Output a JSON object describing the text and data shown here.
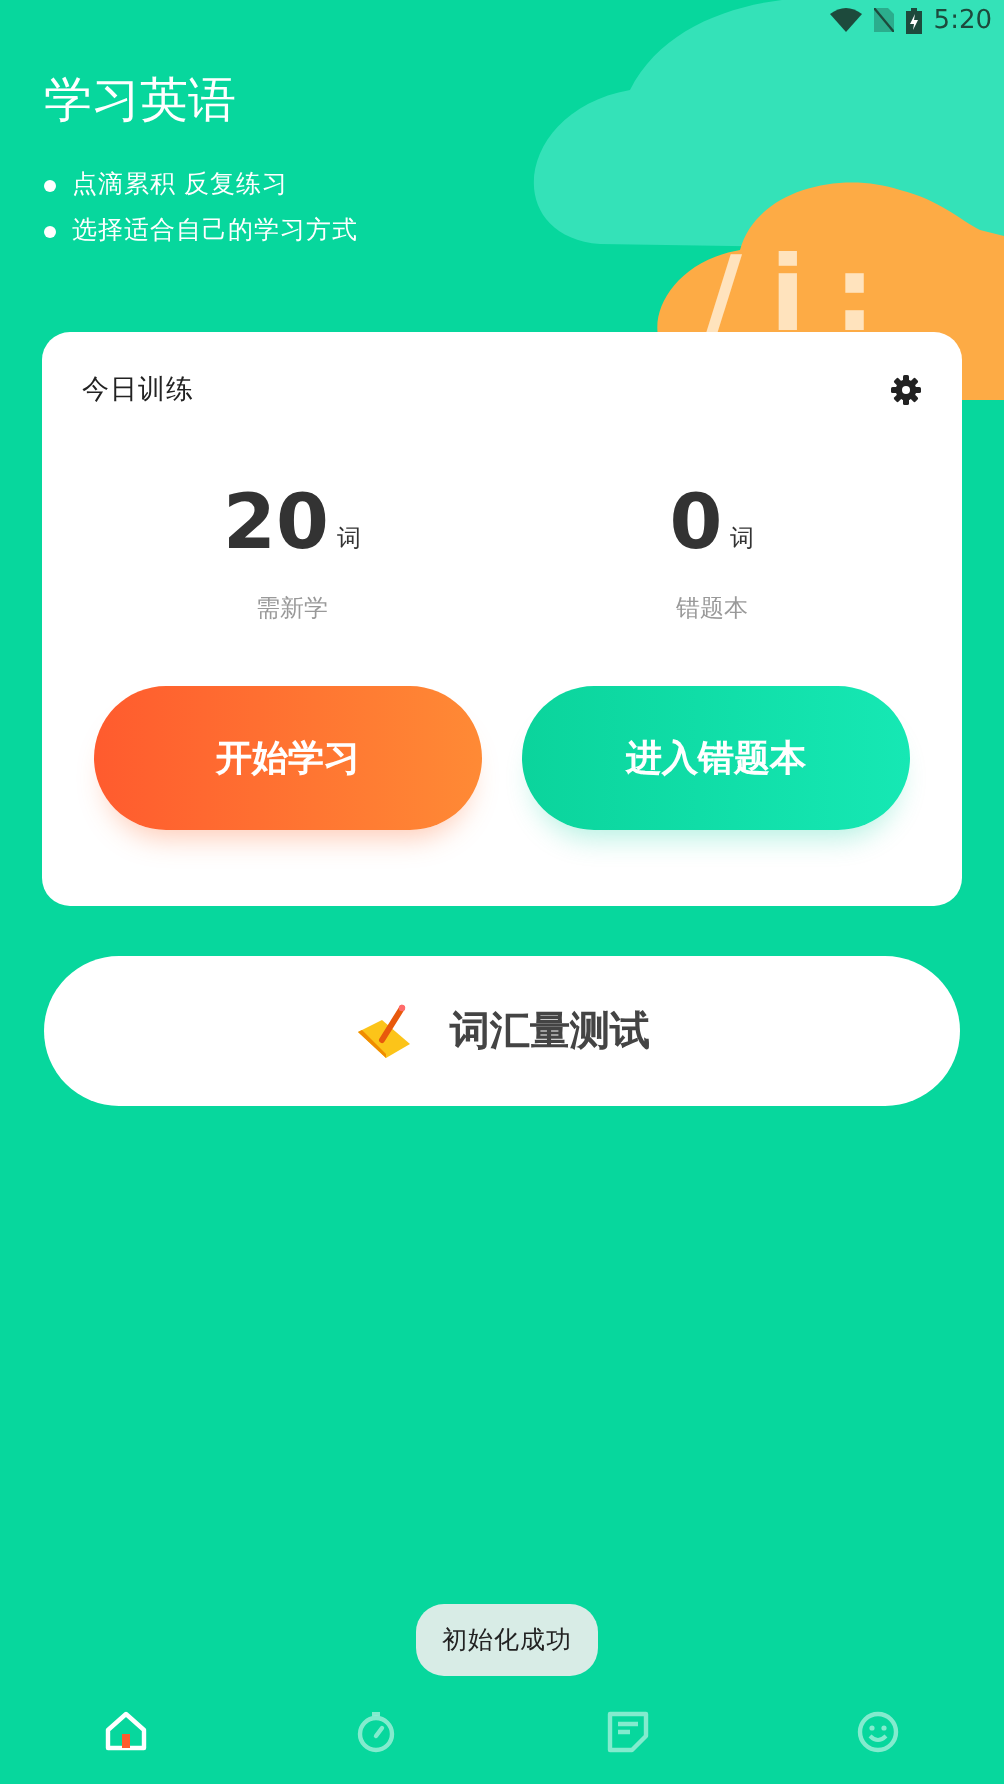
{
  "status_bar": {
    "time": "5:20"
  },
  "header": {
    "title": "学习英语",
    "bullets": [
      "点滴累积 反复练习",
      "选择适合自己的学习方式"
    ],
    "decor_text": "/i:"
  },
  "card": {
    "title": "今日训练",
    "stats": [
      {
        "value": "20",
        "unit": "词",
        "label": "需新学"
      },
      {
        "value": "0",
        "unit": "词",
        "label": "错题本"
      }
    ],
    "buttons": [
      {
        "label": "开始学习",
        "kind": "primary"
      },
      {
        "label": "进入错题本",
        "kind": "secondary"
      }
    ]
  },
  "vocab_button": {
    "label": "词汇量测试"
  },
  "toast": "初始化成功",
  "bottom_nav": [
    {
      "kind": "home",
      "selected": true
    },
    {
      "kind": "timer",
      "selected": false
    },
    {
      "kind": "notes",
      "selected": false
    },
    {
      "kind": "face",
      "selected": false
    }
  ]
}
